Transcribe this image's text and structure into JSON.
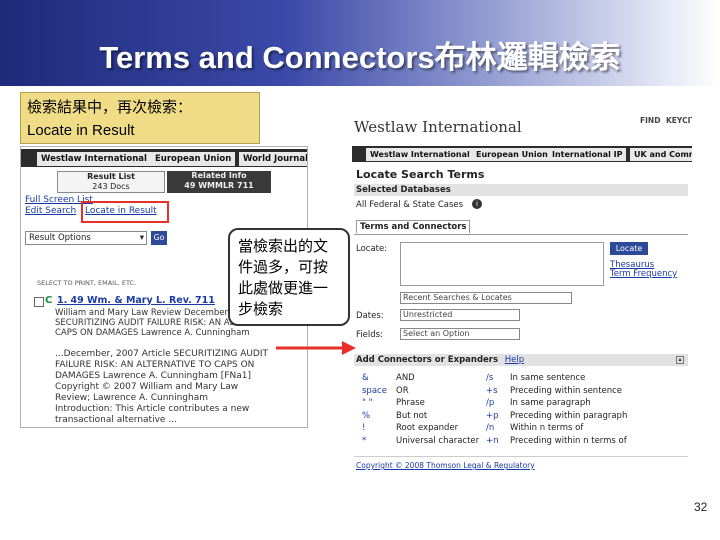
{
  "slide": {
    "title": "Terms and Connectors布林邏輯檢索",
    "callout_result": [
      "檢索結果中，再次檢索：",
      "Locate in Result"
    ],
    "callout_mid": [
      "當檢索出的文",
      "件過多，可按",
      "此處做更進一",
      "步檢索"
    ],
    "page_number": "32"
  },
  "left_panel": {
    "tabs": [
      "Westlaw International",
      "European Union",
      "World Journal"
    ],
    "result_list_label": "Result List",
    "docs_count": "243 Docs",
    "related_info_label": "Related Info",
    "related_info_cite": "49 WMMLR 711",
    "links": [
      "Full Screen List",
      "Edit Search",
      "Locate in Result"
    ],
    "result_options": "Result Options",
    "go_label": "Go",
    "select_label": "SELECT TO PRINT, EMAIL, ETC.",
    "result_cite": "1. 49 Wm. & Mary L. Rev. 711",
    "result_snippet": [
      "William and Mary Law Review December, 200",
      "SECURITIZING AUDIT FAILURE RISK: AN ALTE",
      "CAPS ON DAMAGES Lawrence A. Cunningham"
    ],
    "result_body": [
      "...December, 2007 Article SECURITIZING AUDIT",
      "FAILURE RISK: AN ALTERNATIVE TO CAPS ON",
      "DAMAGES Lawrence A. Cunningham [FNa1]",
      "Copyright © 2007 William and Mary Law",
      "Review; Lawrence A. Cunningham",
      "Introduction: This Article contributes a new",
      "transactional alternative ..."
    ]
  },
  "right_panel": {
    "logo": "Westlaw International",
    "top_links": [
      "FIND",
      "KEYCITE"
    ],
    "tabs": [
      "Westlaw International",
      "European Union",
      "International IP",
      "UK and Commonw"
    ],
    "heading": "Locate Search Terms",
    "selected_databases": "Selected Databases",
    "database": "All Federal & State Cases",
    "terms_tab": "Terms and Connectors",
    "locate_label": "Locate:",
    "locate_button": "Locate",
    "thesaurus": "Thesaurus",
    "term_frequency": "Term Frequency",
    "recent_select": "Recent Searches & Locates",
    "dates_label": "Dates:",
    "dates_value": "Unrestricted",
    "fields_label": "Fields:",
    "fields_value": "Select an Option",
    "connectors_header": "Add Connectors or Expanders",
    "help": "Help",
    "connectors_left": [
      {
        "sym": "&",
        "desc": "AND"
      },
      {
        "sym": "space",
        "desc": "OR"
      },
      {
        "sym": "\" \"",
        "desc": "Phrase"
      },
      {
        "sym": "%",
        "desc": "But not"
      },
      {
        "sym": "!",
        "desc": "Root expander"
      },
      {
        "sym": "*",
        "desc": "Universal character"
      }
    ],
    "connectors_right": [
      {
        "sym": "/s",
        "desc": "In same sentence"
      },
      {
        "sym": "+s",
        "desc": "Preceding within sentence"
      },
      {
        "sym": "/p",
        "desc": "In same paragraph"
      },
      {
        "sym": "+p",
        "desc": "Preceding within paragraph"
      },
      {
        "sym": "/n",
        "desc": "Within n terms of"
      },
      {
        "sym": "+n",
        "desc": "Preceding within n terms of"
      }
    ],
    "footer": "Copyright © 2008 Thomson Legal & Regulatory"
  },
  "colors": {
    "header_dark": "#1e2a7a",
    "callout_fill": "#f0dc86",
    "highlight_red": "#e8302a",
    "link_blue": "#1a3aa8"
  }
}
